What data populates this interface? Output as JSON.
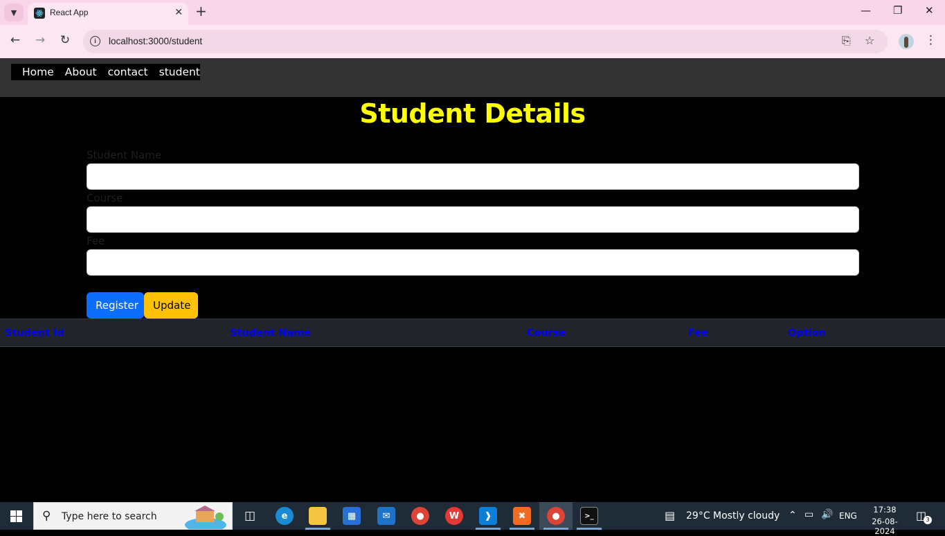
{
  "browser": {
    "tab_title": "React App",
    "url": "localhost:3000/student"
  },
  "nav": {
    "links": [
      "Home",
      "About",
      "contact",
      "student"
    ]
  },
  "page": {
    "title": "Student Details",
    "fields": {
      "student_name_label": "Student Name",
      "course_label": "Course",
      "fee_label": "Fee",
      "student_name_value": "",
      "course_value": "",
      "fee_value": ""
    },
    "buttons": {
      "register": "Register",
      "update": "Update"
    },
    "table": {
      "headers": [
        "Student Id",
        "Student Name",
        "Course",
        "Fee",
        "Option"
      ],
      "rows": []
    }
  },
  "taskbar": {
    "search_placeholder": "Type here to search",
    "weather": "29°C  Mostly cloudy",
    "language": "ENG",
    "time": "17:38",
    "date": "26-08-2024",
    "notifications": "3"
  },
  "colors": {
    "title": "#ffff00",
    "table_header_text": "#0000ff",
    "register_bg": "#0d6efd",
    "update_bg": "#ffc107",
    "navbar_bg": "#333333"
  },
  "icons": {
    "tab_favicon": "react-icon",
    "site_info": "info-icon",
    "install": "install-icon",
    "bookmark": "star-icon"
  }
}
